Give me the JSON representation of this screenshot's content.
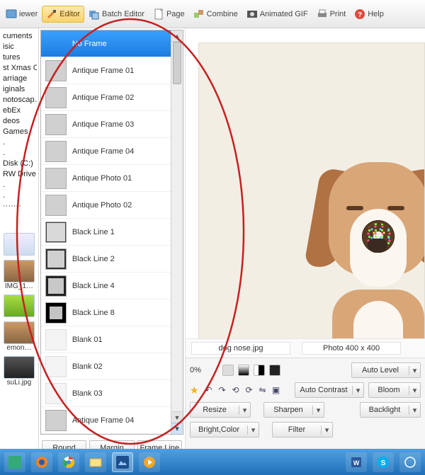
{
  "toolbar": {
    "viewer": "iewer",
    "editor": "Editor",
    "batch": "Batch Editor",
    "page": "Page",
    "combine": "Combine",
    "animated": "Animated GIF",
    "print": "Print",
    "help": "Help"
  },
  "tree": {
    "items": [
      "cuments",
      "isic",
      "tures",
      "st Xmas C",
      "arriage",
      "iginals",
      "notoscap…",
      "ebEx",
      "deos",
      "Games",
      ".",
      ".",
      "Disk (C:)",
      "RW Drive",
      ".",
      ".",
      "·······"
    ]
  },
  "thumbs": [
    {
      "caption": ""
    },
    {
      "caption": "IMG_1…"
    },
    {
      "caption": ""
    },
    {
      "caption": "emon…"
    },
    {
      "caption": "suLi.jpg"
    }
  ],
  "frames": {
    "items": [
      {
        "label": "No Frame",
        "kind": "none",
        "selected": true
      },
      {
        "label": "Antique Frame 01",
        "kind": "plain"
      },
      {
        "label": "Antique Frame 02",
        "kind": "plain"
      },
      {
        "label": "Antique Frame 03",
        "kind": "plain"
      },
      {
        "label": "Antique Frame 04",
        "kind": "plain"
      },
      {
        "label": "Antique Photo 01",
        "kind": "plain"
      },
      {
        "label": "Antique Photo 02",
        "kind": "plain"
      },
      {
        "label": "Black Line 1",
        "kind": "line1"
      },
      {
        "label": "Black Line 2",
        "kind": "line2"
      },
      {
        "label": "Black Line 4",
        "kind": "line4"
      },
      {
        "label": "Black Line 8",
        "kind": "line8"
      },
      {
        "label": "Blank 01",
        "kind": "blank"
      },
      {
        "label": "Blank 02",
        "kind": "blank"
      },
      {
        "label": "Blank 03",
        "kind": "blank"
      },
      {
        "label": "Antique Frame 04",
        "kind": "plain"
      }
    ]
  },
  "frame_buttons": {
    "round": "Round",
    "margin": "Margin",
    "frameline": "Frame Line"
  },
  "status": {
    "filename": "dog nose.jpg",
    "dims": "Photo 400 x 400"
  },
  "controls": {
    "zoom_suffix": "0%",
    "auto_level": "Auto Level",
    "auto_contrast": "Auto Contrast",
    "bloom": "Bloom",
    "resize": "Resize",
    "sharpen": "Sharpen",
    "backlight": "Backlight",
    "bright": "Bright,Color",
    "filter": "Filter"
  },
  "colors": {
    "accent_blue": "#1c7de0",
    "highlight": "#f9d36a",
    "annotation_red": "#c62021"
  }
}
